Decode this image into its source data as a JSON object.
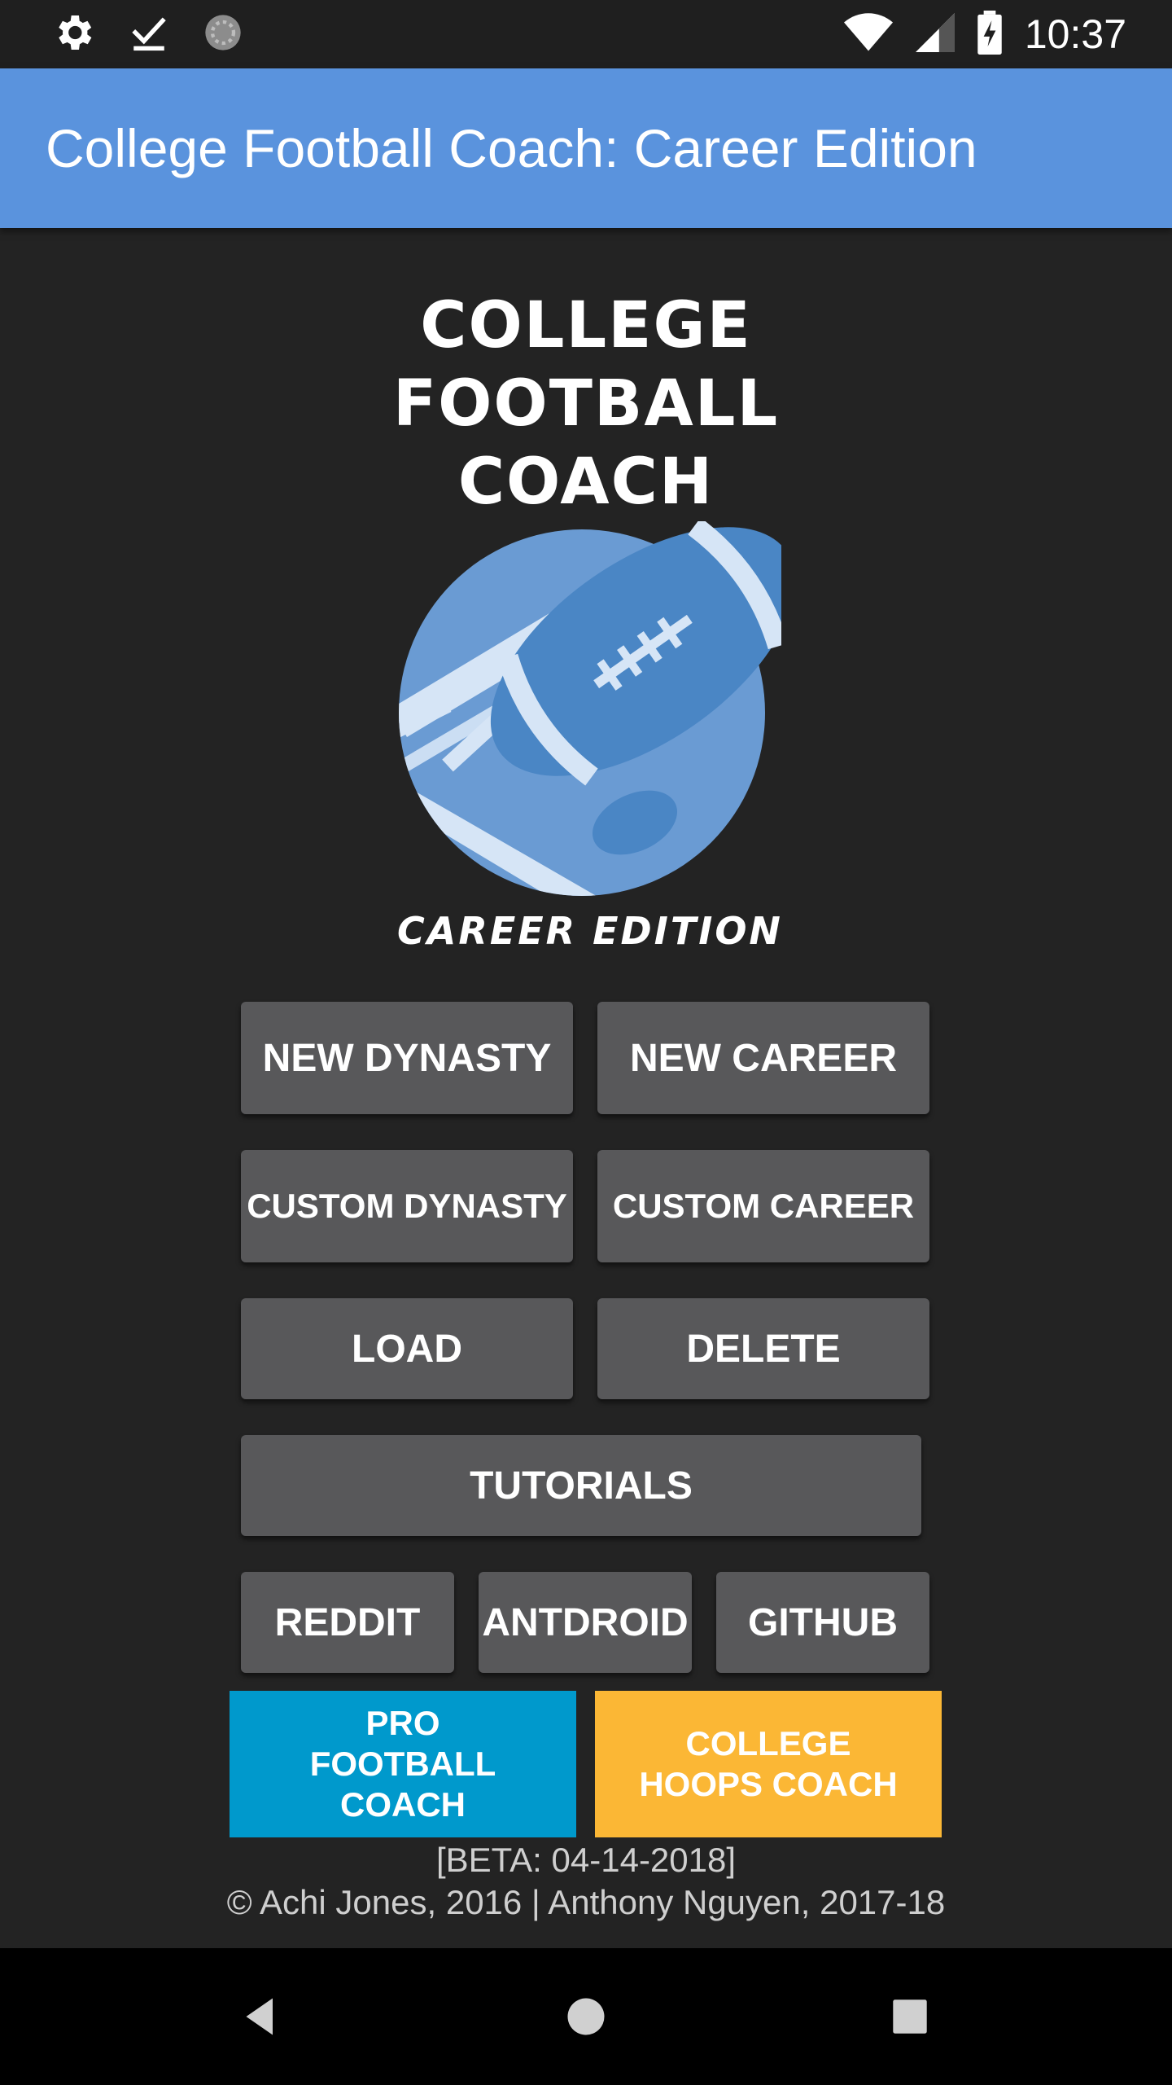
{
  "status_bar": {
    "time": "10:37",
    "icons": [
      "settings-icon",
      "download-done-icon",
      "loading-icon",
      "wifi-icon",
      "signal-icon",
      "battery-charging-icon"
    ]
  },
  "app_bar": {
    "title": "College Football Coach: Career Edition"
  },
  "logo": {
    "lines": [
      "COLLEGE",
      "FOOTBALL",
      "COACH"
    ],
    "subtitle": "CAREER EDITION",
    "colors": {
      "ball": "#4a86c5",
      "circle": "#6a9bd3",
      "stripes": "#d6e5f6"
    }
  },
  "buttons": {
    "new_dynasty": "NEW DYNASTY",
    "new_career": "NEW CAREER",
    "custom_dynasty": "CUSTOM DYNASTY",
    "custom_career": "CUSTOM CAREER",
    "load": "LOAD",
    "delete": "DELETE",
    "tutorials": "TUTORIALS",
    "reddit": "REDDIT",
    "antdroid": "ANTDROID",
    "github": "GITHUB"
  },
  "promos": {
    "pro_football": {
      "label": "PRO FOOTBALL COACH",
      "color": "#0099cc"
    },
    "college_hoops": {
      "label": "COLLEGE HOOPS COACH",
      "color": "#fbb735"
    }
  },
  "footer": {
    "version": "[BETA: 04-14-2018]",
    "credits": "© Achi Jones, 2016 | Anthony Nguyen, 2017-18"
  },
  "nav_bar": {
    "icons": [
      "back-icon",
      "home-icon",
      "recents-icon"
    ]
  }
}
